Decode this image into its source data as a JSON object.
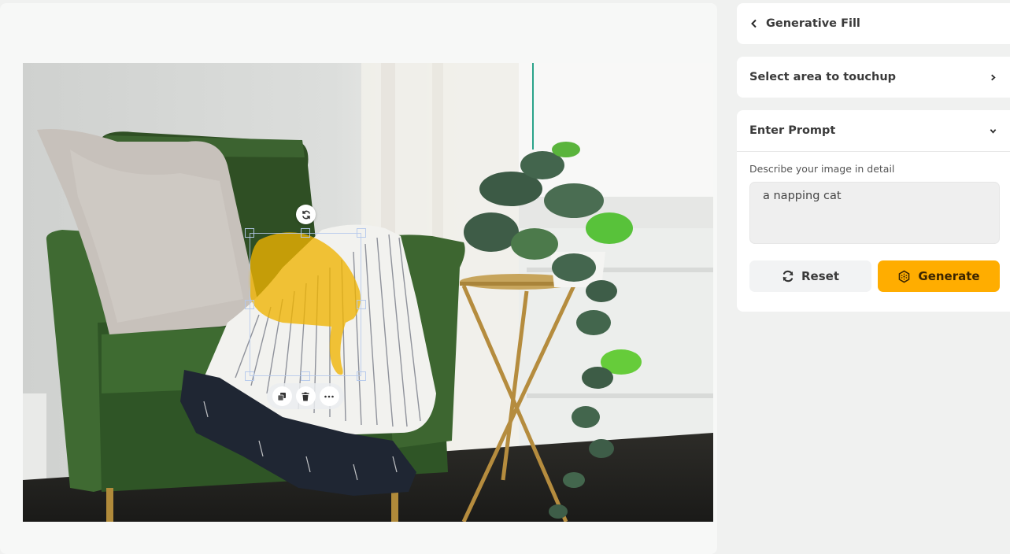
{
  "canvas": {
    "image_description": "Green velvet armchair with beige pillow and striped fringed throw blanket beside a gold side table with a trailing pothos plant near a window",
    "mask_color": "#f0b400"
  },
  "sidebar": {
    "header": {
      "back_icon": "chevron-left-icon",
      "title": "Generative Fill"
    },
    "select_area": {
      "label": "Select area to touchup",
      "icon": "chevron-right-icon"
    },
    "prompt_section": {
      "label": "Enter Prompt",
      "icon": "chevron-down-icon",
      "field_label": "Describe your image in detail",
      "value": "a napping cat"
    },
    "buttons": {
      "reset_label": "Reset",
      "reset_icon": "refresh-icon",
      "generate_label": "Generate",
      "generate_icon": "hexagon-sparkle-icon",
      "generate_color": "#ffad00"
    }
  },
  "selection_toolbar": {
    "rotate_icon": "rotate-icon",
    "actions": [
      "duplicate-icon",
      "trash-icon",
      "more-icon"
    ]
  }
}
